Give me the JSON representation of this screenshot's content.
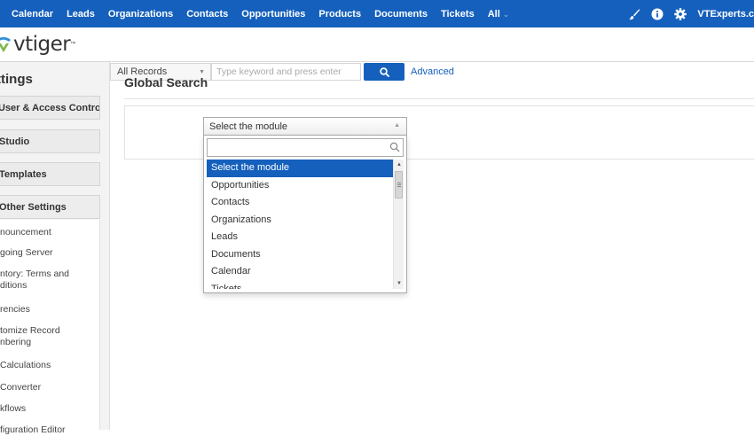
{
  "nav": {
    "links": [
      "Calendar",
      "Leads",
      "Organizations",
      "Contacts",
      "Opportunities",
      "Products",
      "Documents",
      "Tickets",
      "All"
    ],
    "all_caret": "⌄",
    "user": "VTExperts.c"
  },
  "header": {
    "logo": "vtiger",
    "records_select": "All Records",
    "search_placeholder": "Type keyword and press enter",
    "advanced": "Advanced"
  },
  "sidebar": {
    "title": "ttings",
    "sections": [
      "User & Access Control",
      "Studio",
      "Templates",
      "Other Settings"
    ],
    "items": [
      "nouncement",
      "going Server",
      "ntory: Terms and ditions",
      "rencies",
      "tomize Record nbering",
      "Calculations",
      "Converter",
      "kflows",
      "figuration Editor"
    ]
  },
  "main": {
    "title": "Global Search",
    "module_select": "Select the module",
    "dropdown_options": [
      "Select the module",
      "Opportunities",
      "Contacts",
      "Organizations",
      "Leads",
      "Documents",
      "Calendar",
      "Tickets"
    ],
    "selected_index": 0
  },
  "colors": {
    "brand": "#1560bd",
    "sidebar_bg": "#f3f3f3"
  },
  "icons": [
    "brush-icon",
    "info-icon",
    "gear-icon",
    "search-icon",
    "magnifier-icon"
  ]
}
